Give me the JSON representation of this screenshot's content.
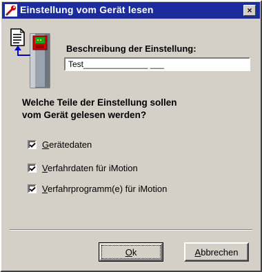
{
  "window": {
    "title": "Einstellung vom Gerät lesen",
    "close_glyph": "×",
    "titlebar_color": "#1b2d9e"
  },
  "description": {
    "label": "Beschreibung der Einstellung:",
    "value": "Test______________ ___"
  },
  "question": {
    "line1": "Welche Teile der Einstellung sollen",
    "line2": "vom Gerät gelesen werden?"
  },
  "options": [
    {
      "first": "G",
      "rest": "erätedaten",
      "checked": true
    },
    {
      "first": "V",
      "rest": "erfahrdaten für iMotion",
      "checked": true
    },
    {
      "first": "V",
      "rest": "erfahrprogramm(e) für iMotion",
      "checked": true
    }
  ],
  "buttons": {
    "ok_first": "O",
    "ok_rest": "k",
    "cancel_first": "A",
    "cancel_rest": "bbrechen"
  },
  "icons": {
    "app": "wrench-icon",
    "document": "document-icon",
    "device": "device-icon",
    "arrow": "arrow-left-icon",
    "checkmark": "checkmark-icon"
  }
}
